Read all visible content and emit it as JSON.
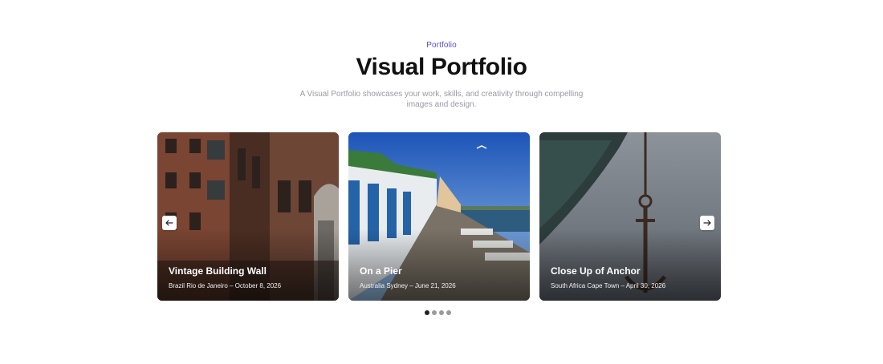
{
  "header": {
    "eyebrow": "Portfolio",
    "title": "Visual Portfolio",
    "subtitle": "A Visual Portfolio showcases your work, skills, and creativity through compelling images and design."
  },
  "cards": [
    {
      "title": "Vintage Building Wall",
      "meta": "Brazil Rio de Janeiro – October 8, 2026"
    },
    {
      "title": "On a Pier",
      "meta": "Australia Sydney – June 21, 2026"
    },
    {
      "title": "Close Up of Anchor",
      "meta": "South Africa Cape Town – April 30, 2026"
    }
  ],
  "pagination": {
    "active_index": 0,
    "count": 4
  },
  "colors": {
    "accent": "#5a4fcf",
    "dot_active": "#222222",
    "dot_inactive": "#9a9a9a"
  }
}
